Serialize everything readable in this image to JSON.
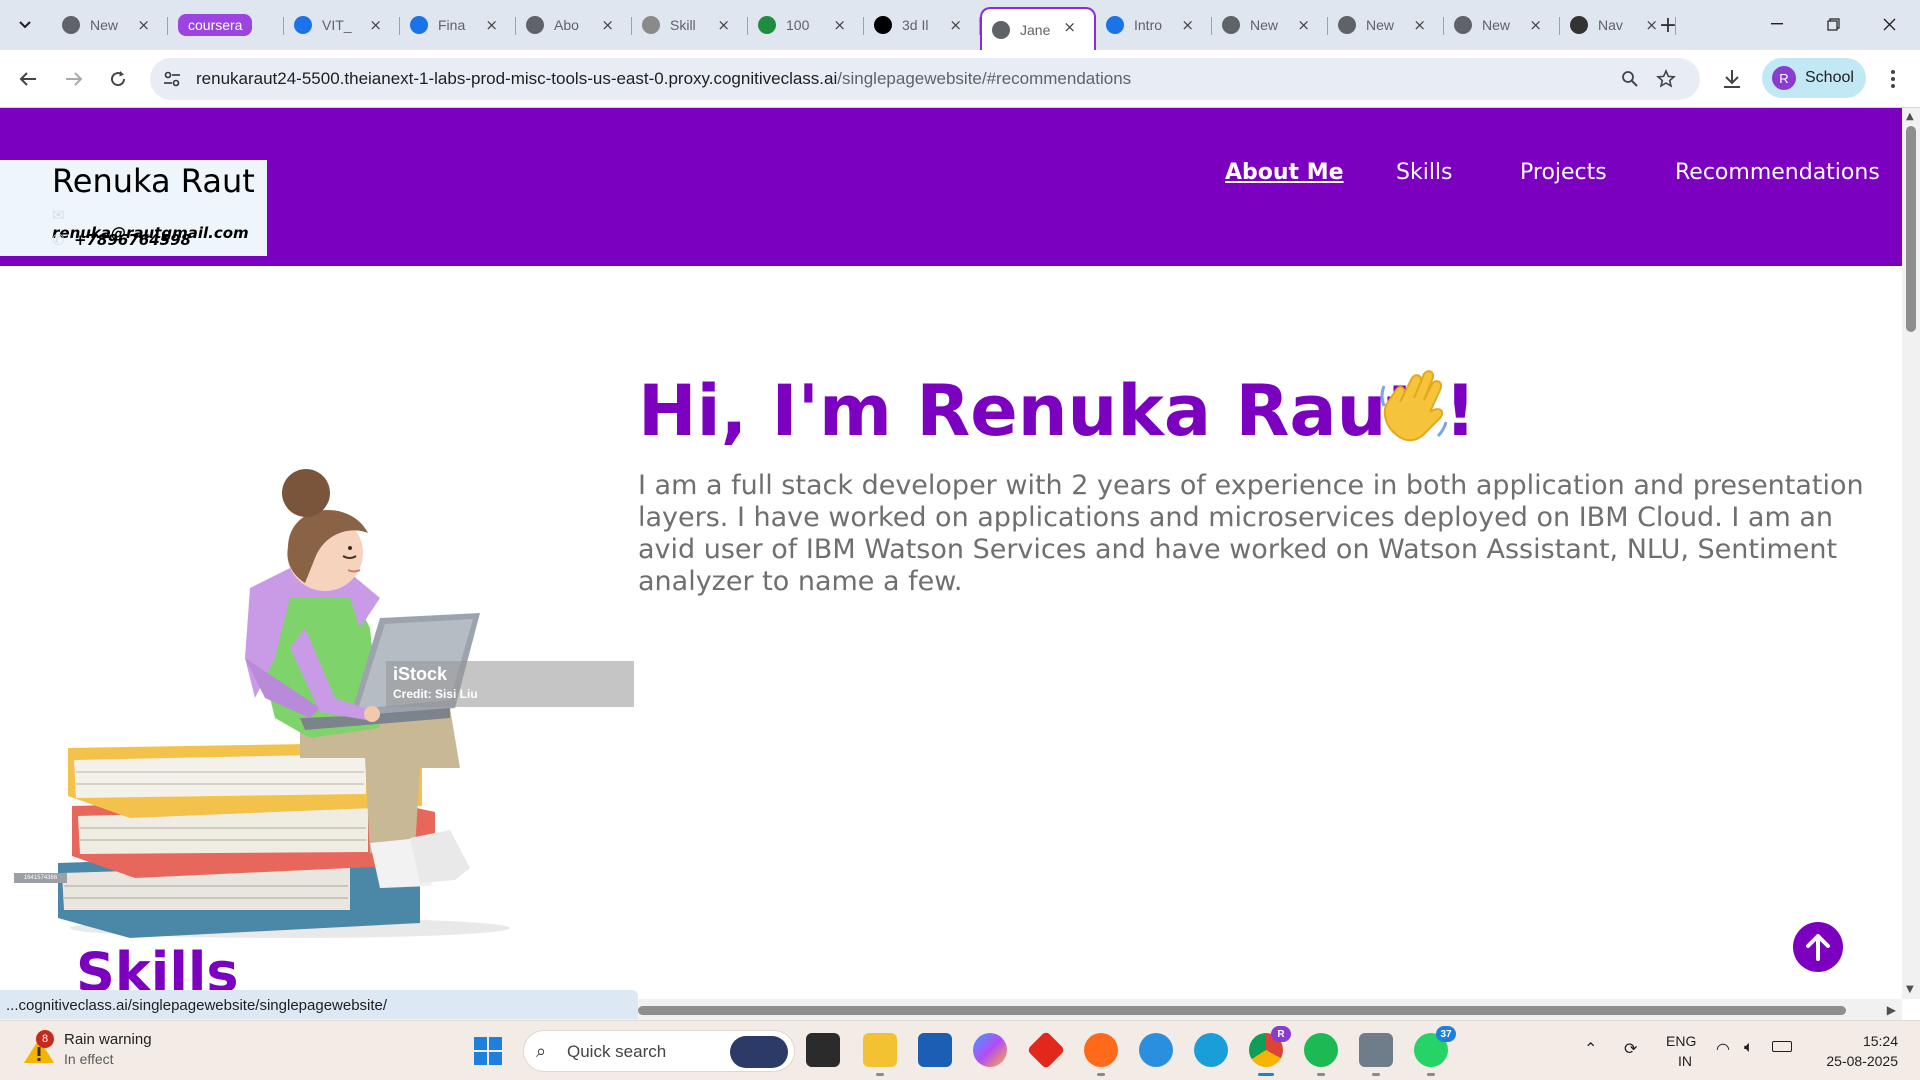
{
  "browser": {
    "tabs": [
      {
        "title": "New",
        "favicon": "globe-icon",
        "color": "#5f6368"
      },
      {
        "title": "coursera",
        "favicon": "coursera-chip",
        "color": "#9b44e0"
      },
      {
        "title": "VIT_",
        "favicon": "cognitiveclass-icon",
        "color": "#1a73e8"
      },
      {
        "title": "Fina",
        "favicon": "cognitiveclass-icon",
        "color": "#1a73e8"
      },
      {
        "title": "Abo",
        "favicon": "globe-icon",
        "color": "#5f6368"
      },
      {
        "title": "Skill",
        "favicon": "openai-icon",
        "color": "#8a8a8a"
      },
      {
        "title": "100",
        "favicon": "px-icon",
        "color": "#1e8e3e"
      },
      {
        "title": "3d Il",
        "favicon": "istock-icon",
        "color": "#000000"
      },
      {
        "title": "Jane",
        "favicon": "globe-icon",
        "color": "#5f6368",
        "active": true
      },
      {
        "title": "Intro",
        "favicon": "cognitiveclass-icon",
        "color": "#1a73e8"
      },
      {
        "title": "New",
        "favicon": "globe-icon",
        "color": "#5f6368"
      },
      {
        "title": "New",
        "favicon": "globe-icon",
        "color": "#5f6368"
      },
      {
        "title": "New",
        "favicon": "globe-icon",
        "color": "#5f6368"
      },
      {
        "title": "Nav",
        "favicon": "openai-icon",
        "color": "#333333"
      }
    ],
    "url": {
      "host": "renukaraut24-5500.theianext-1-labs-prod-misc-tools-us-east-0.proxy.cognitiveclass.ai",
      "path": "/singlepagewebsite/#recommendations"
    },
    "profile_initial": "R",
    "profile_label": "School",
    "status_url": "...cognitiveclass.ai/singlepagewebsite/singlepagewebsite/"
  },
  "page": {
    "name": "Renuka Raut",
    "email": "renuka@rautgmail.com",
    "phone": "+7896764598",
    "nav": [
      "About Me",
      "Skills",
      "Projects",
      "Recommendations"
    ],
    "current_nav": "About Me",
    "hero_title": "Hi, I'm Renuka Raut !",
    "hero_text": "I am a full stack developer with 2 years of experience in both application and presentation layers. I have worked on applications and microservices deployed on IBM Cloud. I am an avid user of IBM Watson Services and have worked on Watson Assistant, NLU, Sentiment analyzer to name a few.",
    "image_credit_brand": "iStock",
    "image_credit_line": "Credit: Sisi Liu",
    "image_id": "1641574366",
    "next_section": "Skills",
    "brand_color": "#7b00c0"
  },
  "taskbar": {
    "weather_title": "Rain warning",
    "weather_sub": "In effect",
    "weather_badge": "8",
    "search_placeholder": "Quick search",
    "whatsapp_badge": "37",
    "chrome_badge": "R",
    "lang": "ENG",
    "region": "IN",
    "time": "15:24",
    "date": "25-08-2025"
  }
}
